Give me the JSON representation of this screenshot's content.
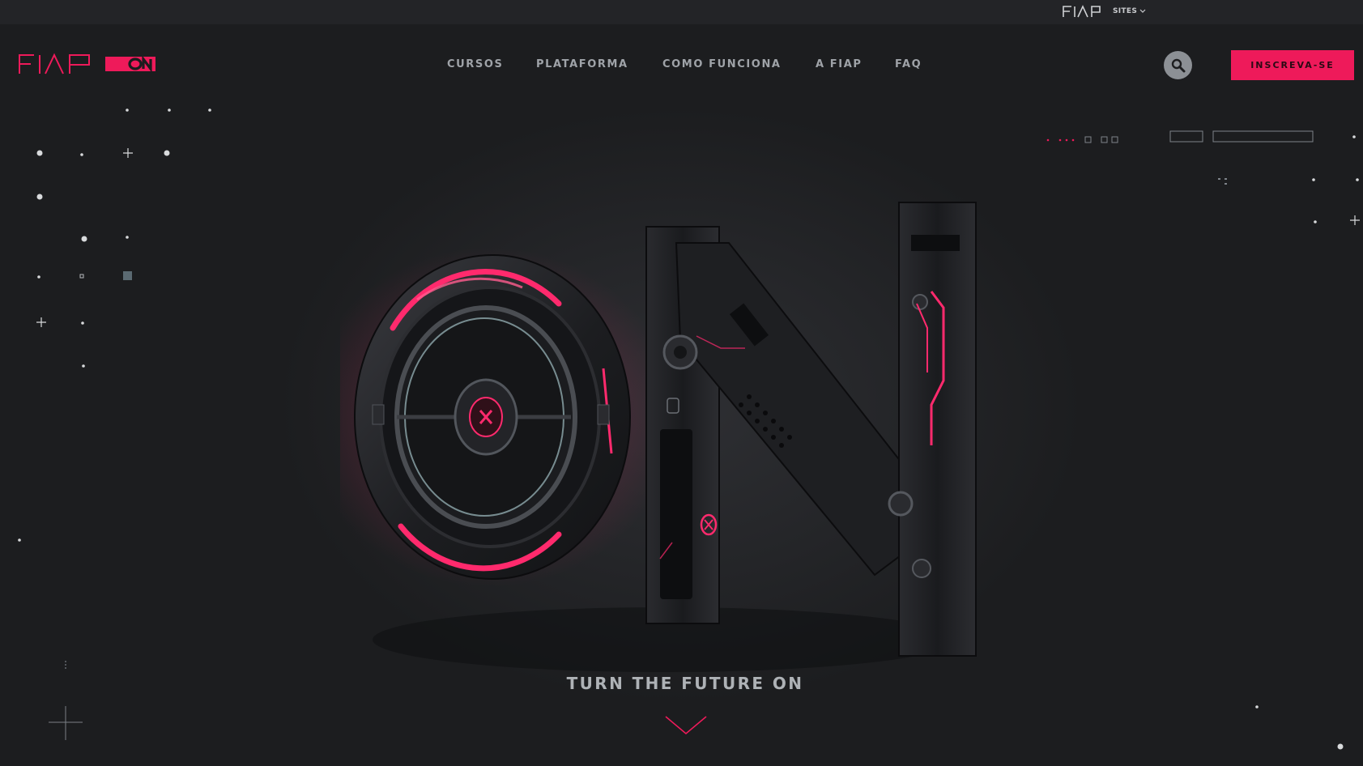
{
  "topbar": {
    "brand_logo_text": "FIAP",
    "sites_label": "SITES"
  },
  "header": {
    "logo_text": "FIAP",
    "logo_badge": "ON",
    "nav": [
      {
        "label": "CURSOS"
      },
      {
        "label": "PLATAFORMA"
      },
      {
        "label": "COMO FUNCIONA"
      },
      {
        "label": "A FIAP"
      },
      {
        "label": "FAQ"
      }
    ],
    "search_icon": "search-icon",
    "cta_label": "INSCREVA-SE"
  },
  "hero": {
    "tagline": "TURN THE FUTURE ON",
    "scroll_icon": "chevron-down-icon"
  },
  "colors": {
    "accent": "#ee1a5a",
    "background": "#1b1c1e",
    "nav_text": "#9fa3a8",
    "neon": "#ff2a6d"
  }
}
